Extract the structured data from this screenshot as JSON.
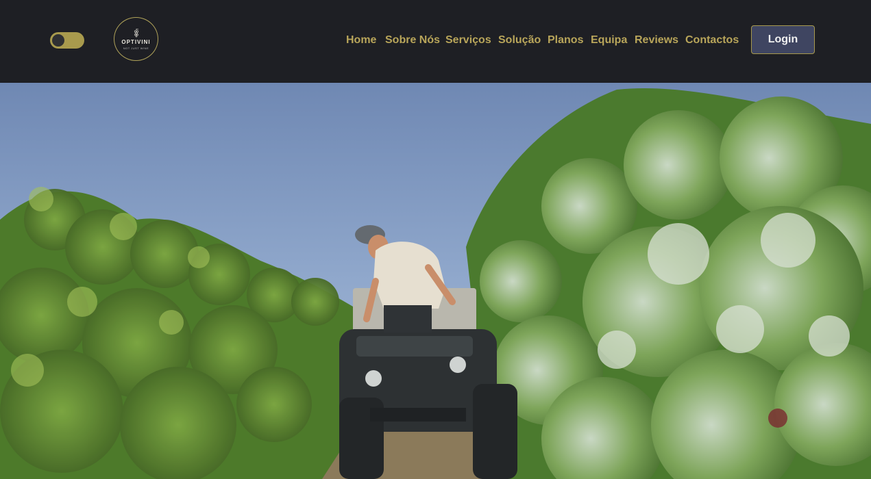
{
  "theme_toggle": {
    "state": "dark"
  },
  "logo": {
    "name": "OPTIVINI",
    "tagline": "NOT JUST WINE",
    "icon": "grapes-icon"
  },
  "nav": {
    "items": [
      {
        "label": "Home"
      },
      {
        "label": "Sobre Nós"
      },
      {
        "label": "Serviços"
      },
      {
        "label": "Solução"
      },
      {
        "label": "Planos"
      },
      {
        "label": "Equipa"
      },
      {
        "label": "Reviews"
      },
      {
        "label": "Contactos"
      }
    ],
    "login_label": "Login"
  },
  "colors": {
    "header_bg": "#1e1f24",
    "accent_gold": "#b8a55a",
    "login_bg": "#3f4561"
  },
  "hero": {
    "image": "vineyard-atv-photo"
  }
}
